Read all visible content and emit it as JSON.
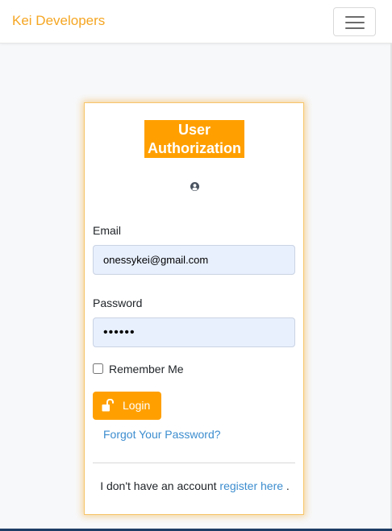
{
  "navbar": {
    "brand": "Kei Developers",
    "toggle_icon": "hamburger-menu-icon",
    "brand_color": "#f5a623"
  },
  "card": {
    "title": "User Authorization",
    "user_icon": "user-circle-icon",
    "email": {
      "label": "Email",
      "value": "onessykei@gmail.com"
    },
    "password": {
      "label": "Password",
      "value": "••••••"
    },
    "remember": {
      "label": "Remember Me",
      "checked": false
    },
    "login": {
      "label": "Login",
      "icon": "unlock-icon"
    },
    "forgot_link": "Forgot Your Password?",
    "register": {
      "prefix": "I don't have an account",
      "link": "register here",
      "suffix": "."
    },
    "accent_color": "#ffa000",
    "link_color": "#3c8dcf"
  }
}
